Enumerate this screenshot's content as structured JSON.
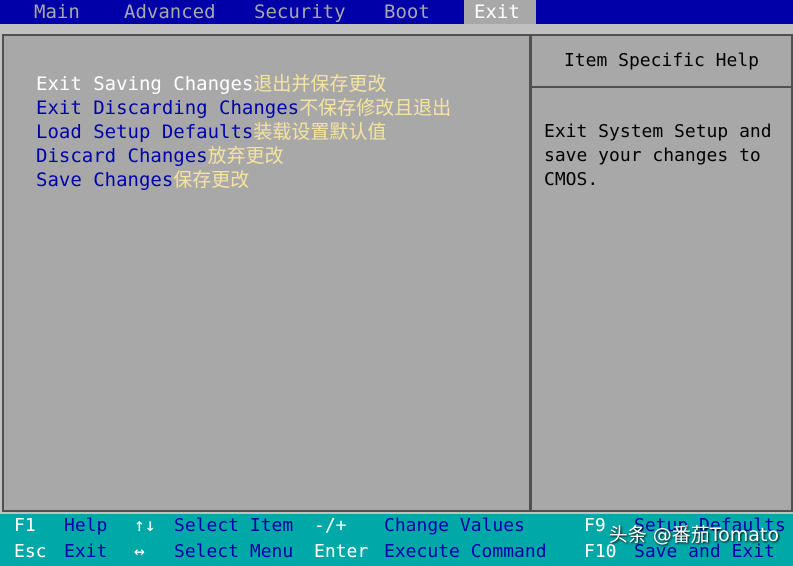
{
  "menubar": {
    "tabs": [
      "Main",
      "Advanced",
      "Security",
      "Boot",
      "Exit"
    ],
    "active": "Exit"
  },
  "exit_menu": {
    "items": [
      {
        "en": "Exit Saving Changes",
        "zh": "退出并保存更改"
      },
      {
        "en": "Exit Discarding Changes",
        "zh": "不保存修改且退出"
      },
      {
        "en": "Load Setup Defaults",
        "zh": "装载设置默认值"
      },
      {
        "en": "Discard Changes",
        "zh": "放弃更改"
      },
      {
        "en": "Save Changes",
        "zh": "保存更改"
      }
    ],
    "selected": "Exit Saving Changes"
  },
  "help": {
    "title": "Item Specific Help",
    "text": "Exit System Setup and\nsave your changes to\nCMOS."
  },
  "keybar": {
    "row1": [
      {
        "key": "F1",
        "desc": "Help"
      },
      {
        "key": "↑↓",
        "desc": "Select Item"
      },
      {
        "key": "-/+",
        "desc": "Change Values"
      },
      {
        "key": "F9",
        "desc": "Setup Defaults"
      }
    ],
    "row2": [
      {
        "key": "Esc",
        "desc": "Exit"
      },
      {
        "key": "↔",
        "desc": "Select Menu"
      },
      {
        "key": "Enter",
        "desc": "Execute Command"
      },
      {
        "key": "F10",
        "desc": "Save and Exit"
      }
    ]
  },
  "watermark": "头条 @番茄Tomato",
  "colors": {
    "bios_blue": "#0000a8",
    "panel_gray": "#a8a8a8",
    "keybar_cyan": "#00a8a8",
    "highlight_white": "#ffffff",
    "annotation_yellow": "#f4e4a0"
  }
}
